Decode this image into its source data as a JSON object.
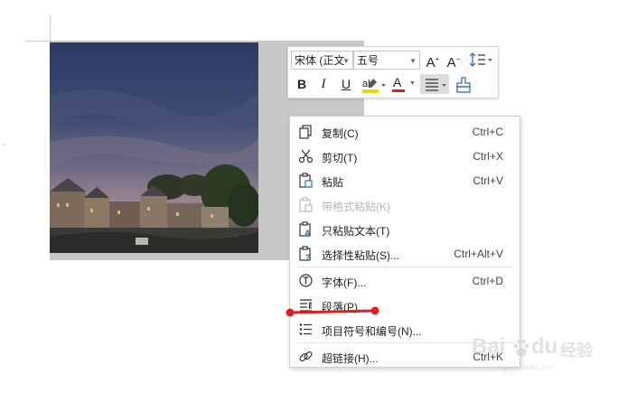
{
  "toolbar": {
    "font_name": "宋体 (正文",
    "font_size": "五号",
    "bold": "B",
    "italic": "I",
    "underline": "U",
    "font_color_letter": "A",
    "grow_font": "A",
    "shrink_font": "A",
    "highlight_colors": {
      "highlight": "#f5d300",
      "font_color": "#e02020"
    }
  },
  "context_menu": {
    "items": [
      {
        "label": "复制(C)",
        "shortcut": "Ctrl+C",
        "icon": "copy-icon",
        "enabled": true
      },
      {
        "label": "剪切(T)",
        "shortcut": "Ctrl+X",
        "icon": "scissors-icon",
        "enabled": true
      },
      {
        "label": "粘贴",
        "shortcut": "Ctrl+V",
        "icon": "paste-icon",
        "enabled": true
      },
      {
        "label": "带格式粘贴(K)",
        "shortcut": "",
        "icon": "paste-format-icon",
        "enabled": false
      },
      {
        "label": "只粘贴文本(T)",
        "shortcut": "",
        "icon": "paste-text-icon",
        "enabled": true
      },
      {
        "label": "选择性粘贴(S)...",
        "shortcut": "Ctrl+Alt+V",
        "icon": "paste-special-icon",
        "enabled": true
      },
      {
        "label": "字体(F)...",
        "shortcut": "Ctrl+D",
        "icon": "font-icon",
        "enabled": true
      },
      {
        "label": "段落(P)...",
        "shortcut": "",
        "icon": "paragraph-icon",
        "enabled": true
      },
      {
        "label": "项目符号和编号(N)...",
        "shortcut": "",
        "icon": "bullet-list-icon",
        "enabled": true
      },
      {
        "label": "超链接(H)...",
        "shortcut": "Ctrl+K",
        "icon": "link-icon",
        "enabled": true
      }
    ]
  },
  "watermark": {
    "brand": "Bai",
    "brand2": "du",
    "suffix": "经验",
    "url": "jingyan.baidu.com"
  },
  "colors": {
    "annotation_red": "#e0201e",
    "selection_gray": "#c8c8c8"
  }
}
